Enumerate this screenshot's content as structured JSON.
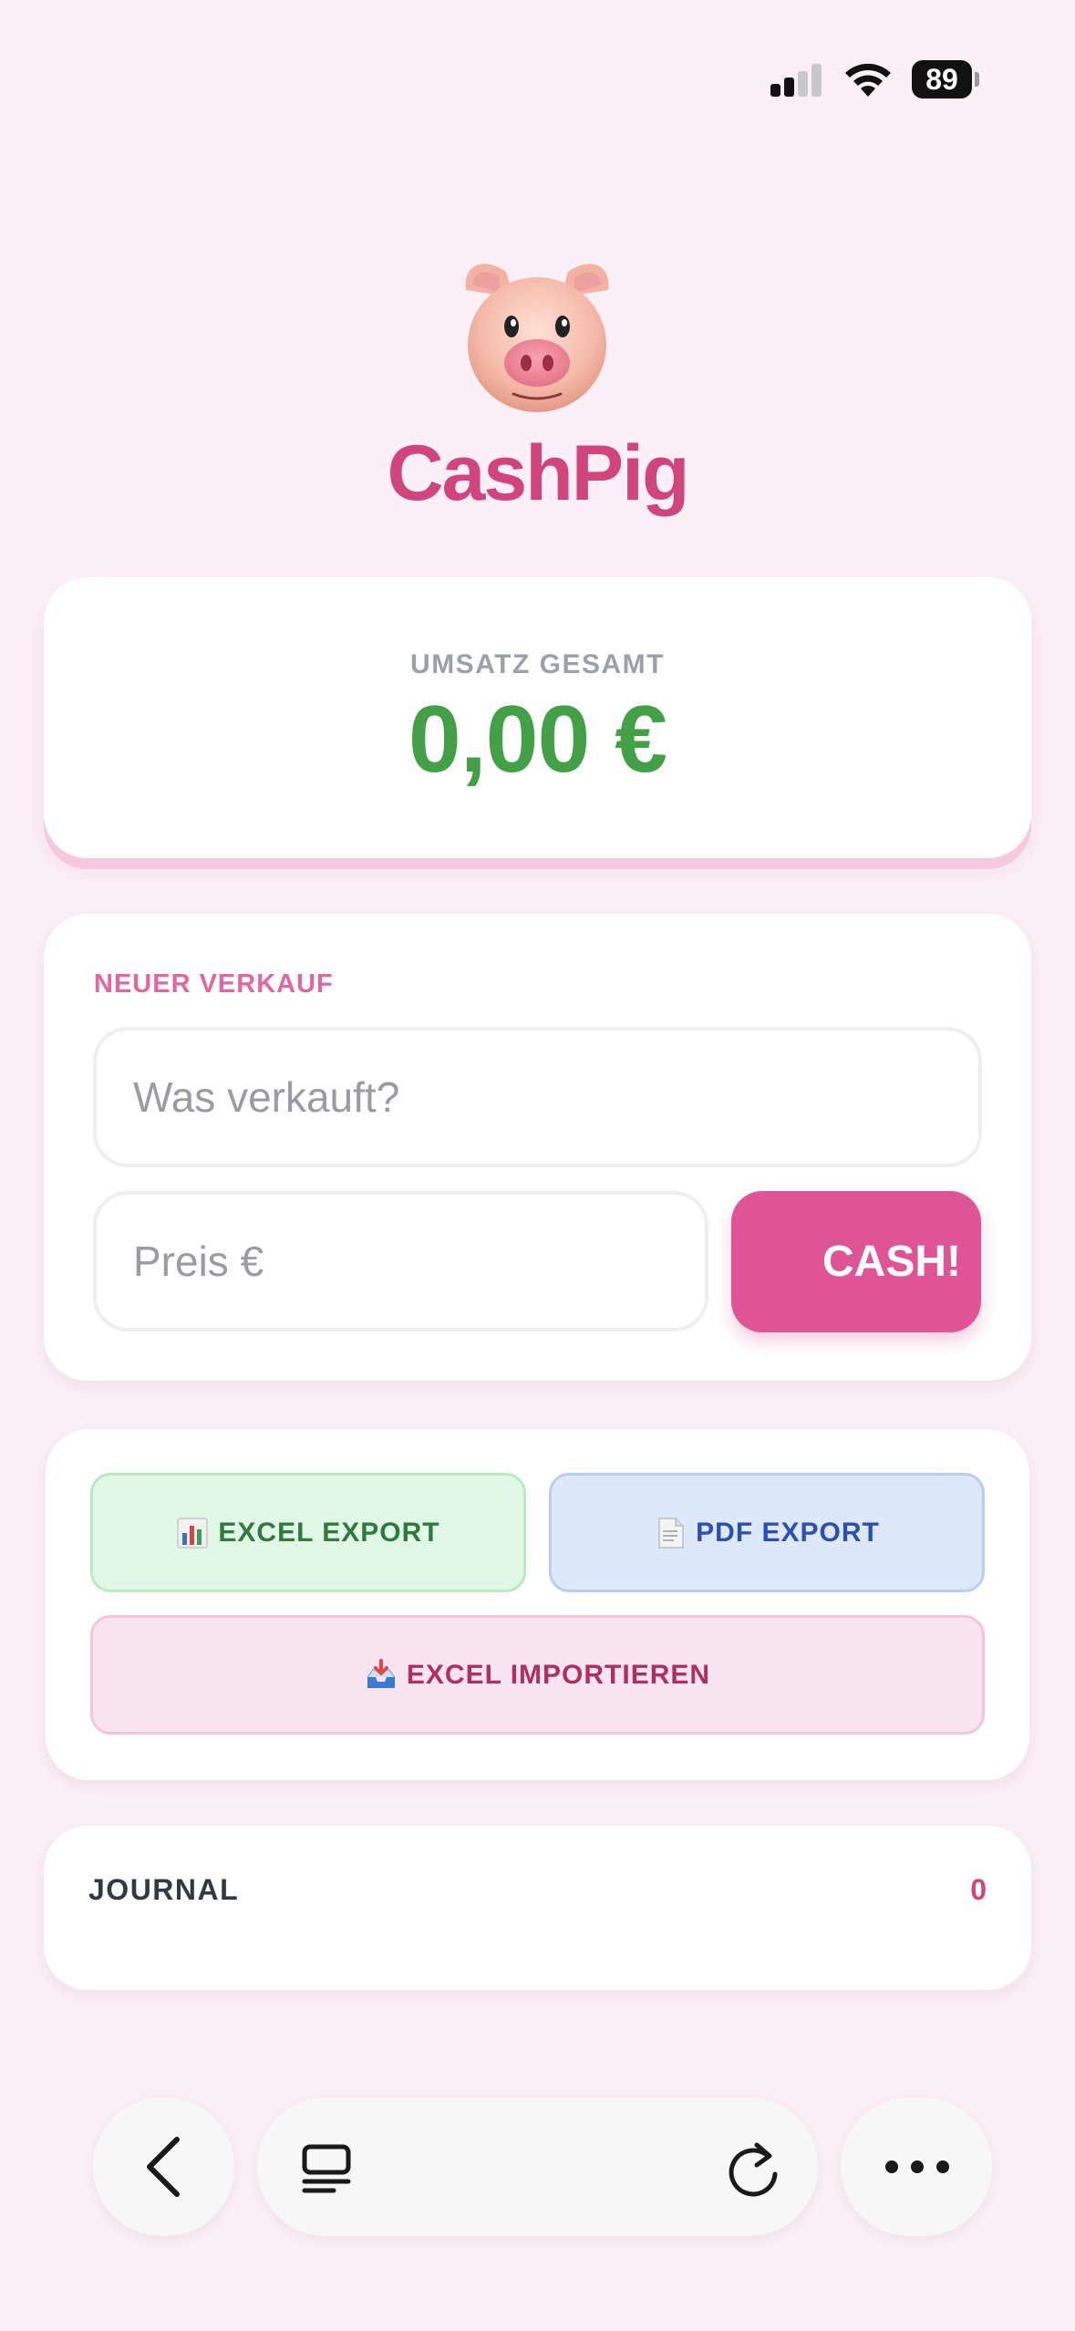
{
  "status_bar": {
    "battery": "89",
    "signal_icon": "cellular-signal-icon",
    "wifi_icon": "wifi-icon",
    "battery_icon": "battery-icon"
  },
  "header": {
    "logo_icon": "pig-face-icon",
    "title": "CashPig"
  },
  "total": {
    "label": "UMSATZ GESAMT",
    "value": "0,00 €"
  },
  "new_sale": {
    "label": "NEUER VERKAUF",
    "item_placeholder": "Was verkauft?",
    "price_placeholder": "Preis €",
    "submit_label": "CASH!"
  },
  "actions": {
    "excel_export": "EXCEL EXPORT",
    "pdf_export": "PDF EXPORT",
    "excel_import": "EXCEL IMPORTIEREN",
    "excel_export_icon": "bar-chart-icon",
    "pdf_export_icon": "document-icon",
    "excel_import_icon": "inbox-tray-icon"
  },
  "journal": {
    "title": "JOURNAL",
    "count": "0"
  },
  "browser_bar": {
    "back_icon": "chevron-left-icon",
    "tabs_icon": "tabs-icon",
    "reload_icon": "reload-icon",
    "more_icon": "more-dots-icon"
  },
  "colors": {
    "background": "#fcf0f6",
    "brand_pink": "#d0457e",
    "cash_button": "#de5495",
    "total_green": "#43a047"
  }
}
